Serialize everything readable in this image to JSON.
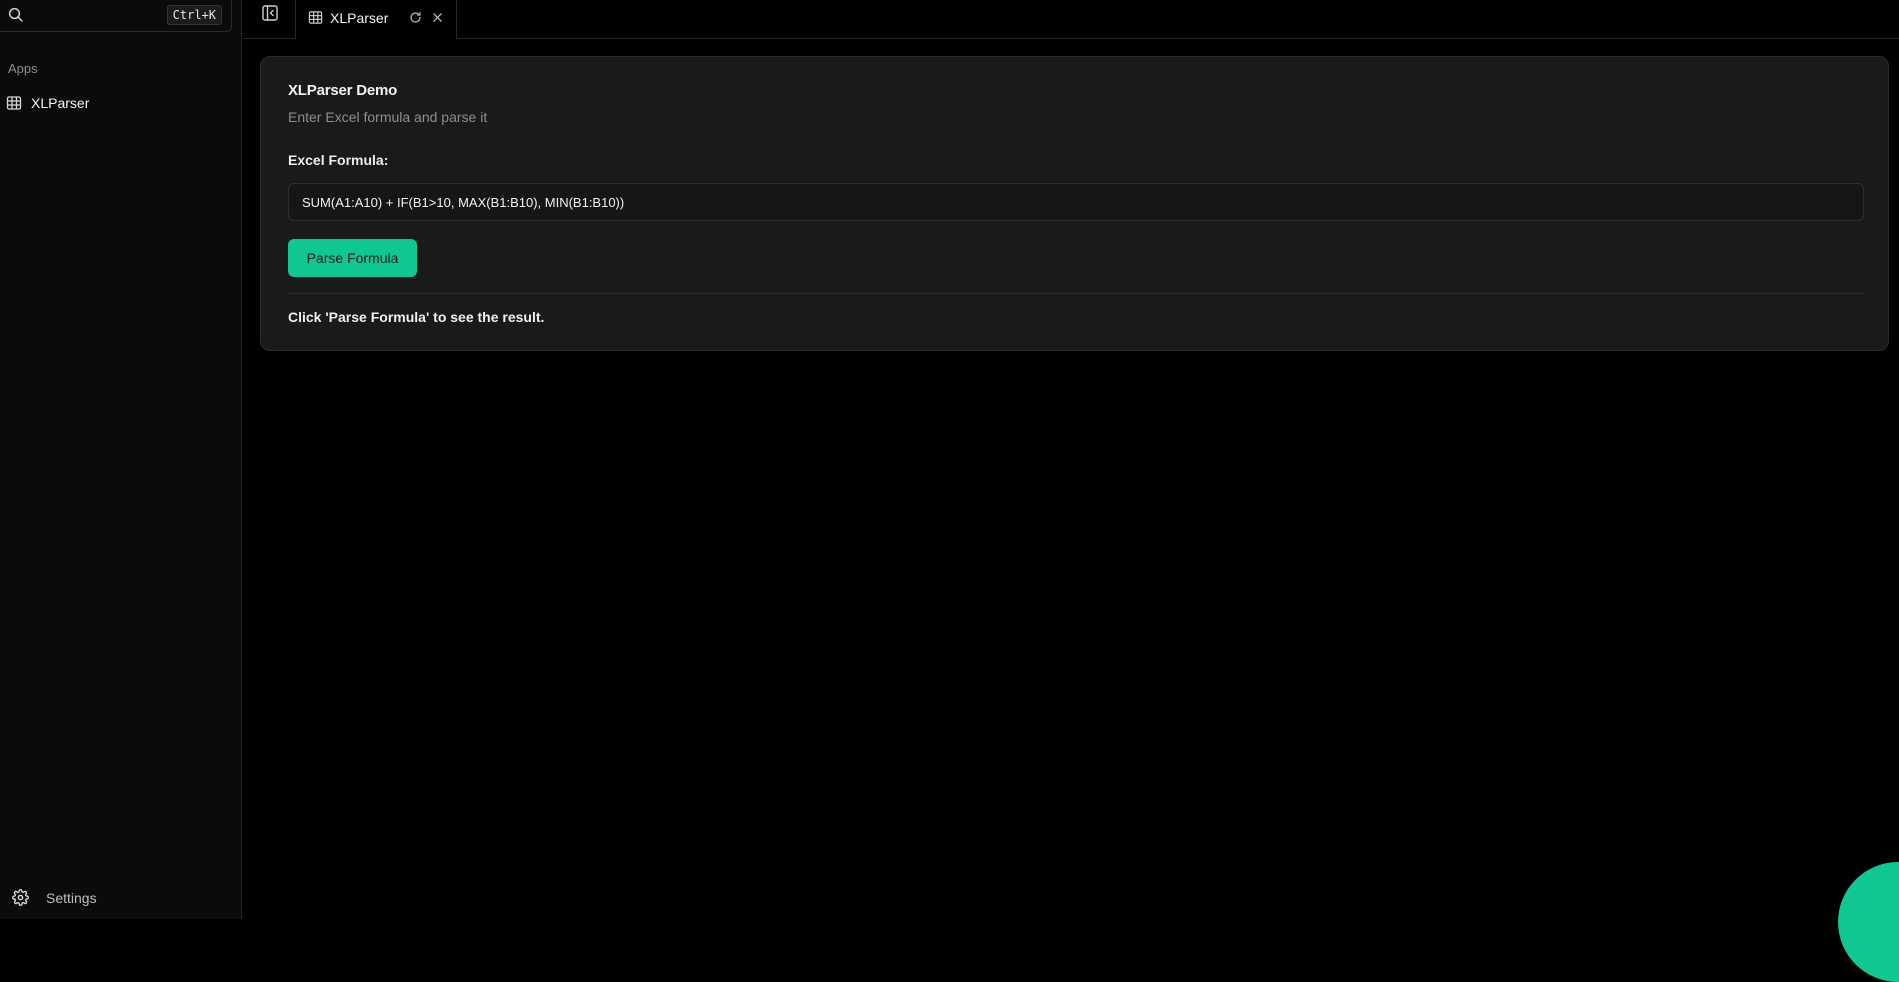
{
  "sidebar": {
    "search": {
      "shortcut": "Ctrl+K"
    },
    "section_label": "Apps",
    "items": [
      {
        "label": "XLParser",
        "icon": "table-icon"
      }
    ],
    "settings_label": "Settings"
  },
  "tabs": [
    {
      "label": "XLParser",
      "icon": "table-icon"
    }
  ],
  "card": {
    "title": "XLParser Demo",
    "subtitle": "Enter Excel formula and parse it",
    "field_label": "Excel Formula:",
    "formula_value": "SUM(A1:A10) + IF(B1>10, MAX(B1:B10), MIN(B1:B10))",
    "button_label": "Parse Formula",
    "result_text": "Click 'Parse Formula' to see the result."
  },
  "colors": {
    "accent": "#0fc791",
    "background": "#000000",
    "card": "#1a1a1a",
    "sidebar": "#0b0b0b"
  }
}
